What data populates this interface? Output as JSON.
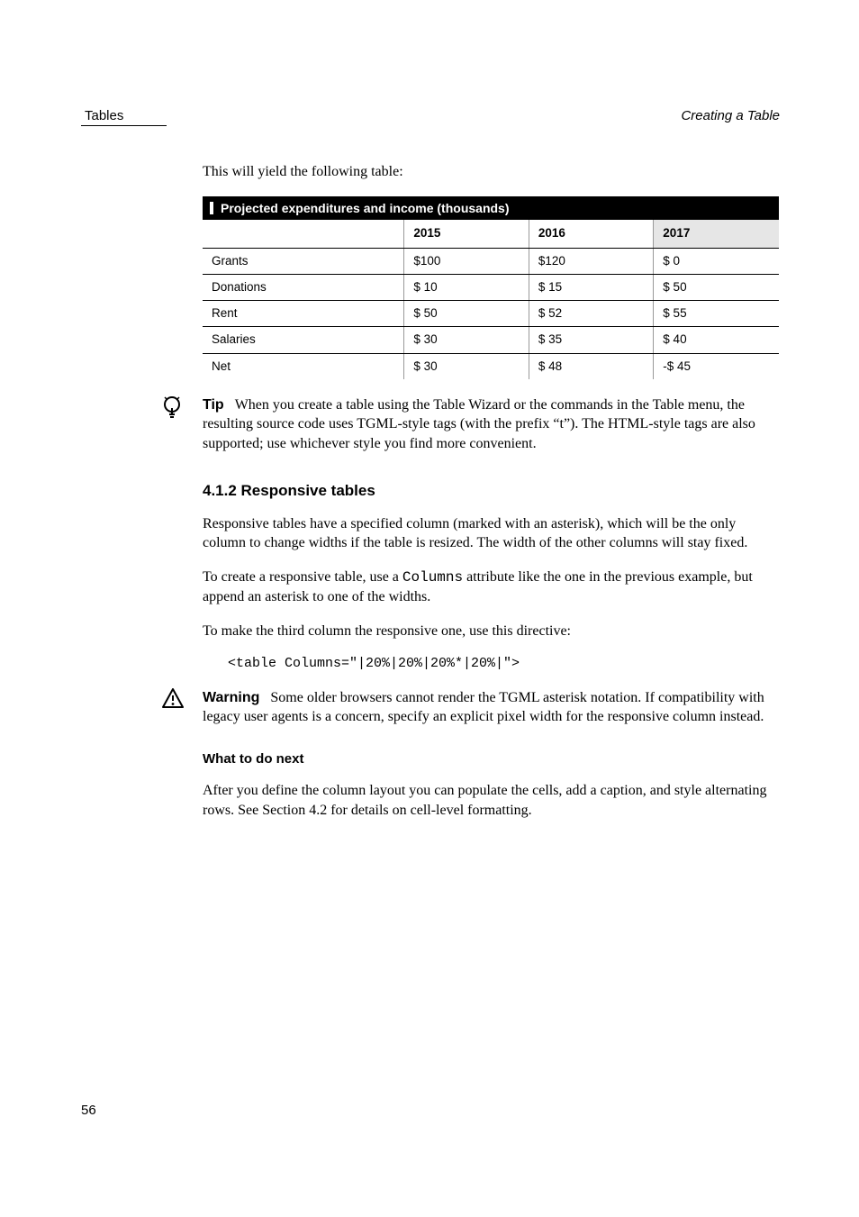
{
  "header": {
    "left": "Tables",
    "right": "Creating a Table"
  },
  "intro": "This will yield the following table:",
  "tip": {
    "label": "Tip",
    "body": "When you create a table using the Table Wizard or the commands in the Table menu, the resulting source code uses TGML-style tags (with the prefix “t”). The HTML-style tags are also supported; use whichever style you find more convenient."
  },
  "section_title": "4.1.2   Responsive tables",
  "responsive": {
    "p1": "Responsive tables have a specified column (marked with an asterisk), which will be the only column to change widths if the table is resized. The width of the other columns will stay fixed.",
    "p2_a": "To create a responsive table, use a ",
    "p2_code": "Columns",
    "p2_b": " attribute like the one in the previous example, but append an asterisk to one of the widths.",
    "p3": "To make the third column the responsive one, use this directive:",
    "code_line": "<table Columns=\"|20%|20%|20%*|20%|\">"
  },
  "warn": {
    "label": "Warning",
    "body": "Some older browsers cannot render the TGML asterisk notation. If compatibility with legacy user agents is a concern, specify an explicit pixel width for the responsive column instead."
  },
  "what_title": "What to do next",
  "what_body": "After you define the column layout you can populate the cells, add a caption, and style alternating rows. See Section 4.2 for details on cell-level formatting.",
  "table": {
    "title": "Projected expenditures and income (thousands)",
    "headers": [
      "",
      "2015",
      "2016",
      "2017"
    ],
    "rows": [
      [
        "Grants",
        "$100",
        "$120",
        "$ 0"
      ],
      [
        "Donations",
        "$ 10",
        "$ 15",
        "$ 50"
      ],
      [
        "Rent",
        "$ 50",
        "$ 52",
        "$ 55"
      ],
      [
        "Salaries",
        "$ 30",
        "$ 35",
        "$ 40"
      ],
      [
        "Net",
        "$ 30",
        "$ 48",
        "-$ 45"
      ]
    ]
  },
  "page_number": "56"
}
